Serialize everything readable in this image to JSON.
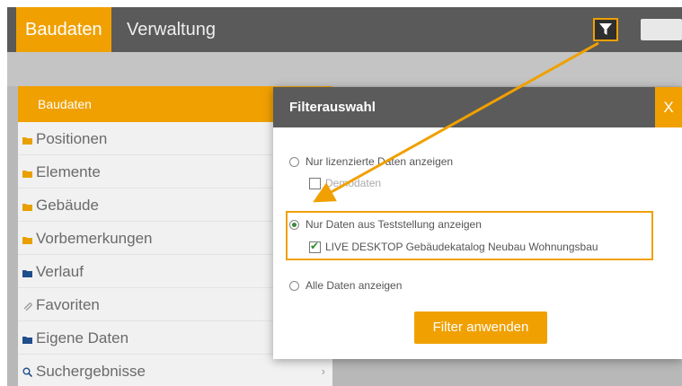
{
  "topbar": {
    "tabs": [
      {
        "label": "Baudaten",
        "active": true
      },
      {
        "label": "Verwaltung",
        "active": false
      }
    ],
    "filter_icon": "filter-funnel-icon"
  },
  "sidebar": {
    "header": "Baudaten",
    "items": [
      {
        "label": "Positionen",
        "icon": "folder-icon"
      },
      {
        "label": "Elemente",
        "icon": "folder-icon"
      },
      {
        "label": "Gebäude",
        "icon": "folder-icon"
      },
      {
        "label": "Vorbemerkungen",
        "icon": "folder-icon"
      },
      {
        "label": "Verlauf",
        "icon": "folder-icon"
      },
      {
        "label": "Favoriten",
        "icon": "paperclip-icon"
      },
      {
        "label": "Eigene Daten",
        "icon": "folder-icon"
      },
      {
        "label": "Suchergebnisse",
        "icon": "search-icon"
      }
    ]
  },
  "dialog": {
    "title": "Filterauswahl",
    "close": "X",
    "options": [
      {
        "label": "Nur lizenzierte Daten anzeigen",
        "selected": false,
        "sub": {
          "label": "Demodaten",
          "checked": false
        }
      },
      {
        "label": "Nur Daten aus Teststellung anzeigen",
        "selected": true,
        "sub": {
          "label": "LIVE DESKTOP Gebäudekatalog Neubau Wohnungsbau",
          "checked": true
        }
      },
      {
        "label": "Alle Daten anzeigen",
        "selected": false
      }
    ],
    "apply_label": "Filter anwenden"
  },
  "colors": {
    "accent": "#f0a000",
    "dark": "#5a5a5a",
    "folder_orange": "#e8a000",
    "folder_blue": "#1f4e8c"
  }
}
